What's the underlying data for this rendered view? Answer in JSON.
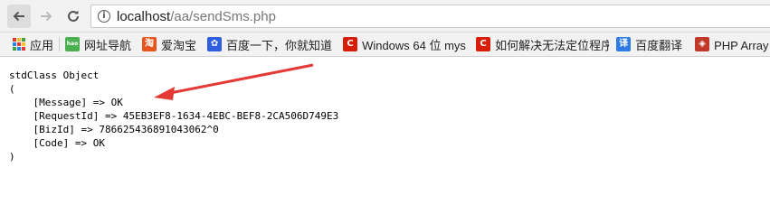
{
  "browser": {
    "url_host": "localhost",
    "url_path": "/aa/sendSms.php",
    "nav": {
      "back": "back-arrow-icon",
      "forward": "forward-arrow-icon",
      "reload": "reload-icon",
      "info": "i"
    }
  },
  "bookmarks": [
    {
      "label": "应用",
      "icon": "apps-grid-icon"
    },
    {
      "label": "网址导航",
      "icon": "hao-icon",
      "icon_text": "hao",
      "color": "#4caf50"
    },
    {
      "label": "爱淘宝",
      "icon": "taobao-icon",
      "icon_text": "淘",
      "color": "#e8541e"
    },
    {
      "label": "百度一下，你就知道",
      "icon": "baidu-paw-icon",
      "icon_text": "✿",
      "color": "#2f5fe0"
    },
    {
      "label": "Windows 64 位 mys",
      "icon": "csdn-icon",
      "icon_text": "C",
      "color": "#d81e06"
    },
    {
      "label": "如何解决无法定位程序",
      "icon": "csdn-icon",
      "icon_text": "C",
      "color": "#d81e06"
    },
    {
      "label": "百度翻译",
      "icon": "translate-icon",
      "icon_text": "译",
      "color": "#2f7be5"
    },
    {
      "label": "PHP Array 函",
      "icon": "php-doc-icon",
      "icon_text": "◈",
      "color": "#c0392b"
    }
  ],
  "output": {
    "lines": [
      "stdClass Object",
      "(",
      "    [Message] => OK",
      "    [RequestId] => 45EB3EF8-1634-4EBC-BEF8-2CA506D749E3",
      "    [BizId] => 786625436891043062^0",
      "    [Code] => OK",
      ")"
    ]
  },
  "annotation": {
    "color": "#e53935",
    "icon": "red-arrow-annotation"
  }
}
